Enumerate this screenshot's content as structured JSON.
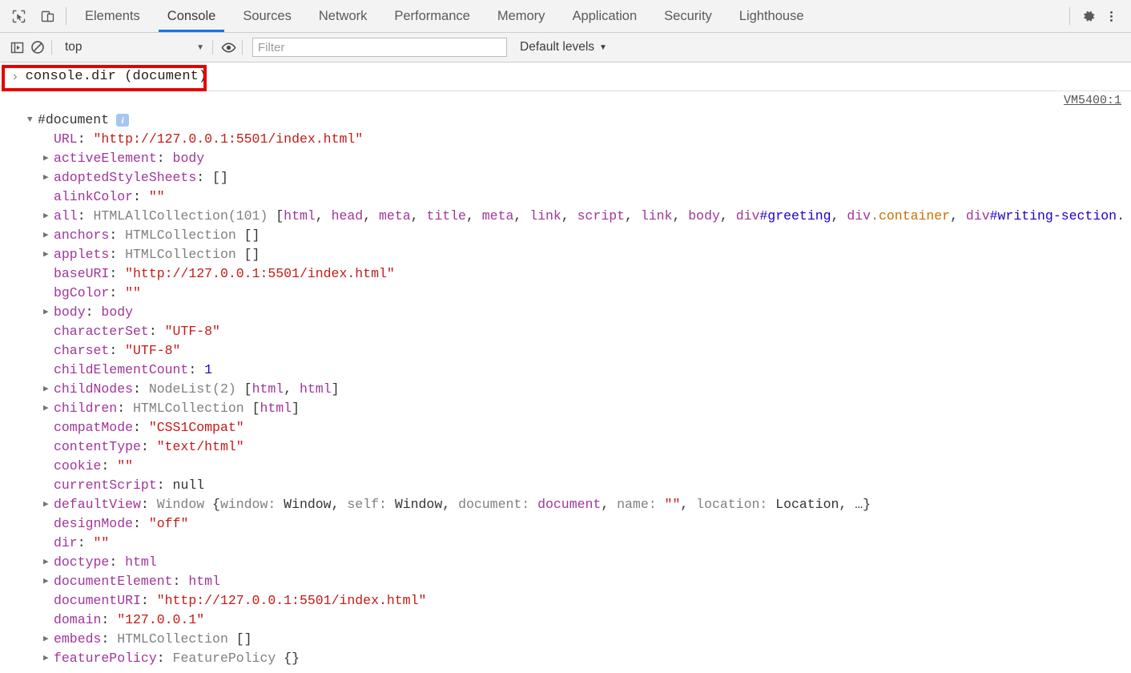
{
  "theme": {
    "accent": "#1a73e8",
    "highlight": "#e60000"
  },
  "tabbar": {
    "icons": [
      {
        "name": "inspect-element-icon",
        "glyph": "inspect"
      },
      {
        "name": "device-toolbar-icon",
        "glyph": "device"
      }
    ],
    "tabs": [
      {
        "label": "Elements",
        "active": false
      },
      {
        "label": "Console",
        "active": true
      },
      {
        "label": "Sources",
        "active": false
      },
      {
        "label": "Network",
        "active": false
      },
      {
        "label": "Performance",
        "active": false
      },
      {
        "label": "Memory",
        "active": false
      },
      {
        "label": "Application",
        "active": false
      },
      {
        "label": "Security",
        "active": false
      },
      {
        "label": "Lighthouse",
        "active": false
      }
    ],
    "settings_icon": "gear-icon",
    "more_icon": "kebab-menu-icon"
  },
  "filterbar": {
    "sidebar_toggle_icon": "console-sidebar-icon",
    "clear_console_icon": "clear-console-icon",
    "context": "top",
    "context_caret": "▼",
    "eye_icon": "live-expression-eye-icon",
    "filter_placeholder": "Filter",
    "filter_value": "",
    "levels_label": "Default levels",
    "levels_caret": "▼"
  },
  "prompt": {
    "chevron": "›",
    "command": "console.dir (document)"
  },
  "source_link": "VM5400:1",
  "tree": {
    "root": {
      "arrow": "▼",
      "name": "#document",
      "info_badge": "i"
    },
    "rows": [
      {
        "arrow": "",
        "name": "URL",
        "parts": [
          {
            "t": " \"http://127.0.0.1:5501/index.html\"",
            "c": "v-str"
          }
        ]
      },
      {
        "arrow": "▶",
        "name": "activeElement",
        "parts": [
          {
            "t": " body",
            "c": "v-obj"
          }
        ]
      },
      {
        "arrow": "▶",
        "name": "adoptedStyleSheets",
        "parts": [
          {
            "t": " []",
            "c": "v-plain"
          }
        ]
      },
      {
        "arrow": "",
        "name": "alinkColor",
        "parts": [
          {
            "t": " \"\"",
            "c": "v-str"
          }
        ]
      },
      {
        "arrow": "▶",
        "name": "all",
        "parts": [
          {
            "t": " HTMLAllCollection(101) ",
            "c": "v-gray"
          },
          {
            "t": "[",
            "c": "v-plain"
          },
          {
            "t": "html",
            "c": "v-obj"
          },
          {
            "t": ", ",
            "c": "v-plain"
          },
          {
            "t": "head",
            "c": "v-obj"
          },
          {
            "t": ", ",
            "c": "v-plain"
          },
          {
            "t": "meta",
            "c": "v-obj"
          },
          {
            "t": ", ",
            "c": "v-plain"
          },
          {
            "t": "title",
            "c": "v-obj"
          },
          {
            "t": ", ",
            "c": "v-plain"
          },
          {
            "t": "meta",
            "c": "v-obj"
          },
          {
            "t": ", ",
            "c": "v-plain"
          },
          {
            "t": "link",
            "c": "v-obj"
          },
          {
            "t": ", ",
            "c": "v-plain"
          },
          {
            "t": "script",
            "c": "v-obj"
          },
          {
            "t": ", ",
            "c": "v-plain"
          },
          {
            "t": "link",
            "c": "v-obj"
          },
          {
            "t": ", ",
            "c": "v-plain"
          },
          {
            "t": "body",
            "c": "v-obj"
          },
          {
            "t": ", ",
            "c": "v-plain"
          },
          {
            "t": "div",
            "c": "v-obj"
          },
          {
            "t": "#greeting",
            "c": "v-id"
          },
          {
            "t": ", ",
            "c": "v-plain"
          },
          {
            "t": "div",
            "c": "v-obj"
          },
          {
            "t": ".container",
            "c": "v-cls"
          },
          {
            "t": ", ",
            "c": "v-plain"
          },
          {
            "t": "div",
            "c": "v-obj"
          },
          {
            "t": "#writing-section",
            "c": "v-id"
          },
          {
            "t": ".",
            "c": "v-plain"
          }
        ]
      },
      {
        "arrow": "▶",
        "name": "anchors",
        "parts": [
          {
            "t": " HTMLCollection ",
            "c": "v-gray"
          },
          {
            "t": "[]",
            "c": "v-plain"
          }
        ]
      },
      {
        "arrow": "▶",
        "name": "applets",
        "parts": [
          {
            "t": " HTMLCollection ",
            "c": "v-gray"
          },
          {
            "t": "[]",
            "c": "v-plain"
          }
        ]
      },
      {
        "arrow": "",
        "name": "baseURI",
        "parts": [
          {
            "t": " \"http://127.0.0.1:5501/index.html\"",
            "c": "v-str"
          }
        ]
      },
      {
        "arrow": "",
        "name": "bgColor",
        "parts": [
          {
            "t": " \"\"",
            "c": "v-str"
          }
        ]
      },
      {
        "arrow": "▶",
        "name": "body",
        "parts": [
          {
            "t": " body",
            "c": "v-obj"
          }
        ]
      },
      {
        "arrow": "",
        "name": "characterSet",
        "parts": [
          {
            "t": " \"UTF-8\"",
            "c": "v-str"
          }
        ]
      },
      {
        "arrow": "",
        "name": "charset",
        "parts": [
          {
            "t": " \"UTF-8\"",
            "c": "v-str"
          }
        ]
      },
      {
        "arrow": "",
        "name": "childElementCount",
        "parts": [
          {
            "t": " 1",
            "c": "v-num"
          }
        ]
      },
      {
        "arrow": "▶",
        "name": "childNodes",
        "parts": [
          {
            "t": " NodeList(2) ",
            "c": "v-gray"
          },
          {
            "t": "[",
            "c": "v-plain"
          },
          {
            "t": "html",
            "c": "v-obj"
          },
          {
            "t": ", ",
            "c": "v-plain"
          },
          {
            "t": "html",
            "c": "v-obj"
          },
          {
            "t": "]",
            "c": "v-plain"
          }
        ]
      },
      {
        "arrow": "▶",
        "name": "children",
        "parts": [
          {
            "t": " HTMLCollection ",
            "c": "v-gray"
          },
          {
            "t": "[",
            "c": "v-plain"
          },
          {
            "t": "html",
            "c": "v-obj"
          },
          {
            "t": "]",
            "c": "v-plain"
          }
        ]
      },
      {
        "arrow": "",
        "name": "compatMode",
        "parts": [
          {
            "t": " \"CSS1Compat\"",
            "c": "v-str"
          }
        ]
      },
      {
        "arrow": "",
        "name": "contentType",
        "parts": [
          {
            "t": " \"text/html\"",
            "c": "v-str"
          }
        ]
      },
      {
        "arrow": "",
        "name": "cookie",
        "parts": [
          {
            "t": " \"\"",
            "c": "v-str"
          }
        ]
      },
      {
        "arrow": "",
        "name": "currentScript",
        "parts": [
          {
            "t": " null",
            "c": "v-plain"
          }
        ]
      },
      {
        "arrow": "▶",
        "name": "defaultView",
        "parts": [
          {
            "t": " Window ",
            "c": "v-gray"
          },
          {
            "t": "{",
            "c": "v-plain"
          },
          {
            "t": "window: ",
            "c": "v-gray"
          },
          {
            "t": "Window",
            "c": "v-plain"
          },
          {
            "t": ", ",
            "c": "v-plain"
          },
          {
            "t": "self: ",
            "c": "v-gray"
          },
          {
            "t": "Window",
            "c": "v-plain"
          },
          {
            "t": ", ",
            "c": "v-plain"
          },
          {
            "t": "document: ",
            "c": "v-gray"
          },
          {
            "t": "document",
            "c": "v-obj"
          },
          {
            "t": ", ",
            "c": "v-plain"
          },
          {
            "t": "name: ",
            "c": "v-gray"
          },
          {
            "t": "\"\"",
            "c": "v-str"
          },
          {
            "t": ", ",
            "c": "v-plain"
          },
          {
            "t": "location: ",
            "c": "v-gray"
          },
          {
            "t": "Location",
            "c": "v-plain"
          },
          {
            "t": ", …}",
            "c": "v-plain"
          }
        ]
      },
      {
        "arrow": "",
        "name": "designMode",
        "parts": [
          {
            "t": " \"off\"",
            "c": "v-str"
          }
        ]
      },
      {
        "arrow": "",
        "name": "dir",
        "parts": [
          {
            "t": " \"\"",
            "c": "v-str"
          }
        ]
      },
      {
        "arrow": "▶",
        "name": "doctype",
        "parts": [
          {
            "t": " html",
            "c": "v-obj"
          }
        ]
      },
      {
        "arrow": "▶",
        "name": "documentElement",
        "parts": [
          {
            "t": " html",
            "c": "v-obj"
          }
        ]
      },
      {
        "arrow": "",
        "name": "documentURI",
        "parts": [
          {
            "t": " \"http://127.0.0.1:5501/index.html\"",
            "c": "v-str"
          }
        ]
      },
      {
        "arrow": "",
        "name": "domain",
        "parts": [
          {
            "t": " \"127.0.0.1\"",
            "c": "v-str"
          }
        ]
      },
      {
        "arrow": "▶",
        "name": "embeds",
        "parts": [
          {
            "t": " HTMLCollection ",
            "c": "v-gray"
          },
          {
            "t": "[]",
            "c": "v-plain"
          }
        ]
      },
      {
        "arrow": "▶",
        "name": "featurePolicy",
        "parts": [
          {
            "t": " FeaturePolicy ",
            "c": "v-gray"
          },
          {
            "t": "{}",
            "c": "v-plain"
          }
        ]
      }
    ]
  }
}
